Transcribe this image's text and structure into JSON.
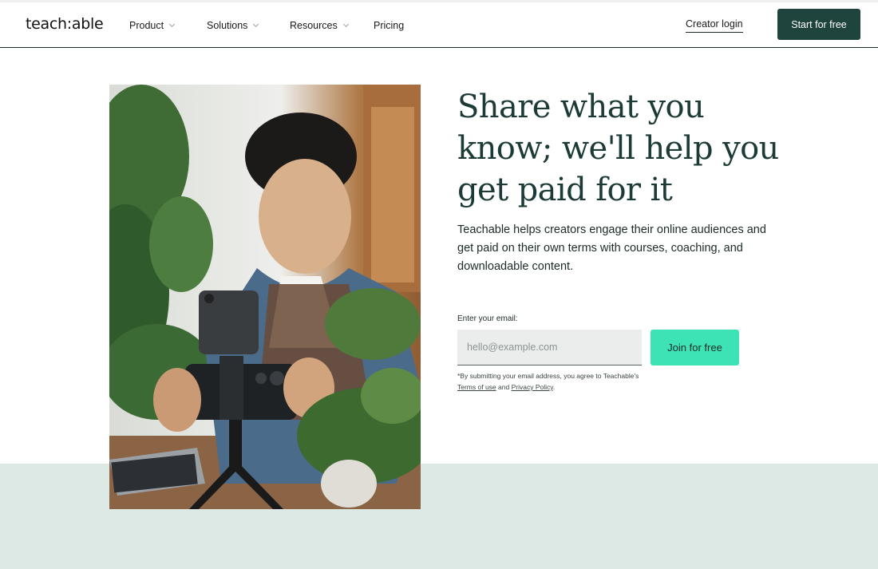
{
  "nav": {
    "logo": "teach:able",
    "items": [
      {
        "label": "Product",
        "has_dropdown": true
      },
      {
        "label": "Solutions",
        "has_dropdown": true
      },
      {
        "label": "Resources",
        "has_dropdown": true
      },
      {
        "label": "Pricing",
        "has_dropdown": false
      }
    ],
    "creator_login": "Creator login",
    "start_button": "Start for free"
  },
  "hero": {
    "headline": "Share what you know; we'll help you get paid for it",
    "subheadline": "Teachable helps creators engage their online audiences and get paid on their own terms with courses, coaching, and downloadable content.",
    "email_label": "Enter your email:",
    "email_placeholder": "hello@example.com",
    "join_button": "Join for free",
    "disclaimer": {
      "prefix": "*By submitting your email address, you agree to Teachable's",
      "terms": "Terms of use",
      "and": "and",
      "privacy": "Privacy Policy",
      "suffix": "."
    }
  },
  "colors": {
    "brand_dark": "#1f433d",
    "accent_mint": "#3de3b5",
    "band": "#dce9e4"
  }
}
